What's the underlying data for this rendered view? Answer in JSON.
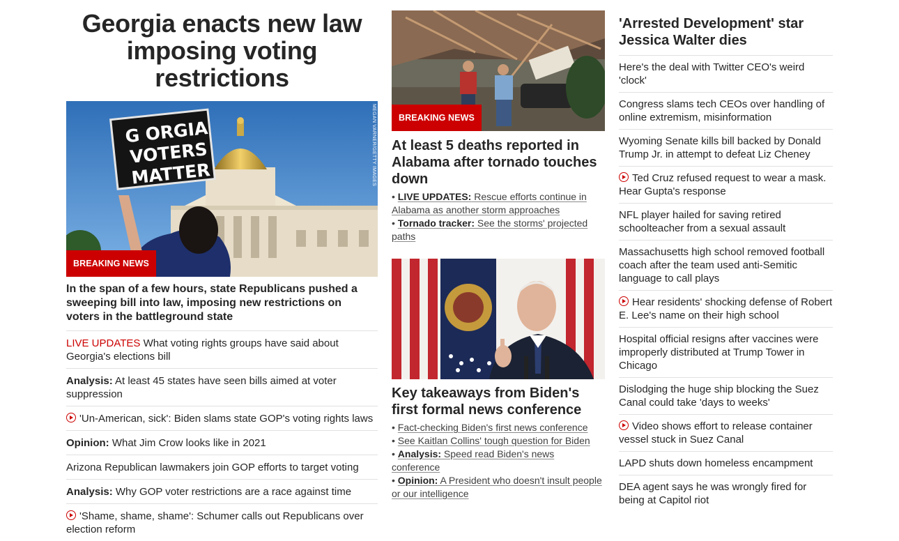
{
  "left": {
    "headline": "Georgia enacts new law imposing voting restrictions",
    "hero_badge": "BREAKING NEWS",
    "hero_credit": "MEGAN VARNER/GETTY IMAGES",
    "sign_text": [
      "G  ORGIA",
      "VOTERS",
      "MATTER"
    ],
    "summary": "In the span of a few hours, state Republicans pushed a sweeping bill into law, imposing new restrictions on voters in the battleground state",
    "items": [
      {
        "prefix": "LIVE UPDATES",
        "prefix_style": "live",
        "text": " What voting rights groups have said about Georgia's elections bill",
        "video": false
      },
      {
        "prefix": "Analysis:",
        "prefix_style": "bold",
        "text": " At least 45 states have seen bills aimed at voter suppression",
        "video": false
      },
      {
        "prefix": "",
        "prefix_style": "",
        "text": "'Un-American, sick': Biden slams state GOP's voting rights laws",
        "video": true
      },
      {
        "prefix": "Opinion:",
        "prefix_style": "bold",
        "text": " What Jim Crow looks like in 2021",
        "video": false
      },
      {
        "prefix": "",
        "prefix_style": "",
        "text": "Arizona Republican lawmakers join GOP efforts to target voting",
        "video": false
      },
      {
        "prefix": "Analysis:",
        "prefix_style": "bold",
        "text": " Why GOP voter restrictions are a race against time",
        "video": false
      },
      {
        "prefix": "",
        "prefix_style": "",
        "text": "'Shame, shame, shame': Schumer calls out Republicans over election reform",
        "video": true
      }
    ]
  },
  "middle": {
    "story1": {
      "badge": "BREAKING NEWS",
      "headline": "At least 5 deaths reported in Alabama after tornado touches down",
      "bullets": [
        {
          "label": "LIVE UPDATES:",
          "text": " Rescue efforts continue in Alabama as another storm approaches"
        },
        {
          "label": "Tornado tracker:",
          "text": " See the storms' projected paths"
        }
      ]
    },
    "story2": {
      "headline": "Key takeaways from Biden's first formal news conference",
      "bullets": [
        {
          "label": "",
          "text": "Fact-checking Biden's first news conference"
        },
        {
          "label": "",
          "text": "See Kaitlan Collins' tough question for Biden"
        },
        {
          "label": "Analysis:",
          "text": " Speed read Biden's news conference"
        },
        {
          "label": "Opinion:",
          "text": " A President who doesn't insult people or our intelligence"
        }
      ]
    }
  },
  "right": {
    "headline": "'Arrested Development' star Jessica Walter dies",
    "items": [
      {
        "text": "Here's the deal with Twitter CEO's weird 'clock'",
        "video": false
      },
      {
        "text": "Congress slams tech CEOs over handling of online extremism, misinformation",
        "video": false
      },
      {
        "text": "Wyoming Senate kills bill backed by Donald Trump Jr. in attempt to defeat Liz Cheney",
        "video": false
      },
      {
        "text": "Ted Cruz refused request to wear a mask. Hear Gupta's response",
        "video": true
      },
      {
        "text": "NFL player hailed for saving retired schoolteacher from a sexual assault",
        "video": false
      },
      {
        "text": "Massachusetts high school removed football coach after the team used anti-Semitic language to call plays",
        "video": false
      },
      {
        "text": "Hear residents' shocking defense of Robert E. Lee's name on their high school",
        "video": true
      },
      {
        "text": "Hospital official resigns after vaccines were improperly distributed at Trump Tower in Chicago",
        "video": false
      },
      {
        "text": "Dislodging the huge ship blocking the Suez Canal could take 'days to weeks'",
        "video": false
      },
      {
        "text": "Video shows effort to release container vessel stuck in Suez Canal",
        "video": true
      },
      {
        "text": "LAPD shuts down homeless encampment",
        "video": false
      },
      {
        "text": "DEA agent says he was wrongly fired for being at Capitol riot",
        "video": false
      }
    ]
  },
  "colors": {
    "brand_red": "#cc0000",
    "text": "#262626",
    "divider": "#e1e1e1"
  }
}
